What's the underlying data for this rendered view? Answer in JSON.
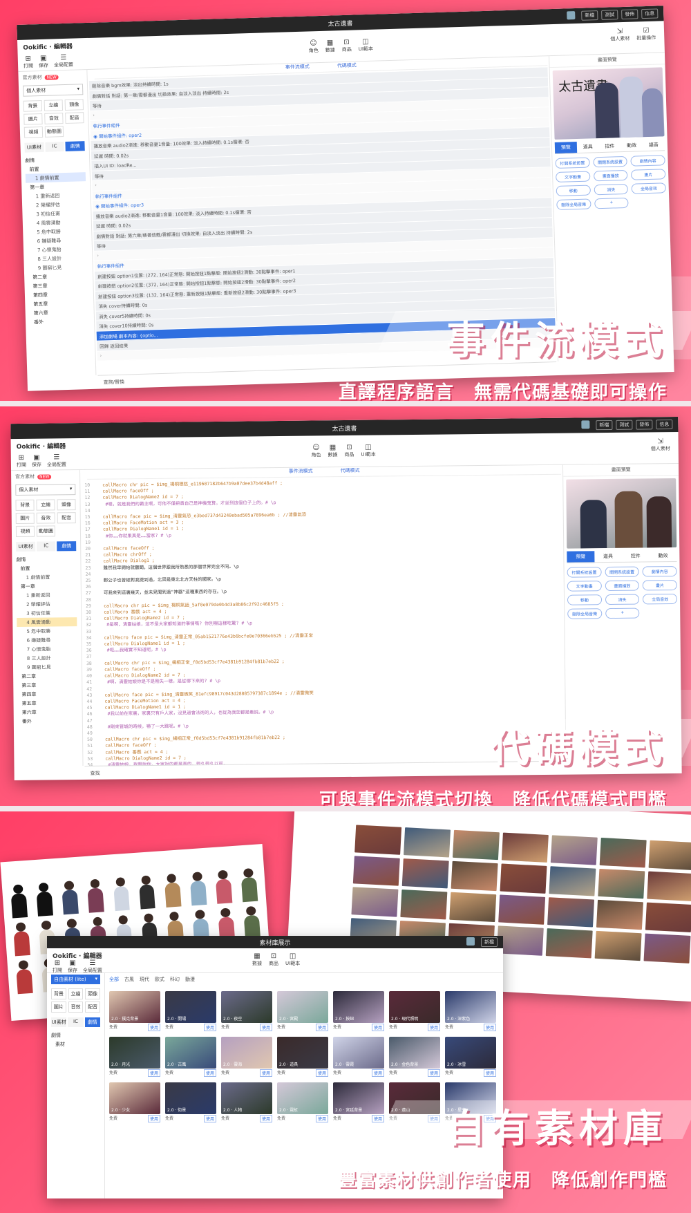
{
  "app": {
    "logo": "Ookific · 編輯器",
    "project_title": "太古遺書",
    "library_title": "素材庫展示",
    "top_controls": [
      "新檔",
      "測試",
      "發佈",
      "信息"
    ],
    "left_tools": [
      {
        "icon": "plus-icon",
        "label": "打開"
      },
      {
        "icon": "save-icon",
        "label": "保存"
      },
      {
        "icon": "list-icon",
        "label": "全局配置"
      }
    ],
    "center_tools": [
      {
        "icon": "person-icon",
        "label": "角色"
      },
      {
        "icon": "grid-icon",
        "label": "數據"
      },
      {
        "icon": "shop-icon",
        "label": "商品"
      },
      {
        "icon": "ui-icon",
        "label": "UI範本"
      }
    ],
    "right_tools": [
      {
        "icon": "import-icon",
        "label": "個人素材"
      },
      {
        "icon": "check-icon",
        "label": "批量操作"
      }
    ]
  },
  "sidebar": {
    "header": "官方素材",
    "badge": "NEW",
    "select": "個人素材",
    "categories": [
      "背景",
      "立繪",
      "頭像",
      "圖片",
      "音效",
      "配音",
      "視頻",
      "動態圖"
    ],
    "tabs": [
      "UI素材",
      "IC",
      "劇情"
    ],
    "tree": [
      {
        "label": "劇情",
        "level": 0
      },
      {
        "label": "前置",
        "level": 1
      },
      {
        "label": "1 劇情前置",
        "level": 2
      },
      {
        "label": "第一章",
        "level": 1
      },
      {
        "label": "1 重新返回",
        "level": 2
      },
      {
        "label": "2 榮耀評估",
        "level": 2
      },
      {
        "label": "3 初信任黨",
        "level": 2
      },
      {
        "label": "4 風雲湧動",
        "level": 2
      },
      {
        "label": "5 危中取勝",
        "level": 2
      },
      {
        "label": "6 嫌疑難尋",
        "level": 2
      },
      {
        "label": "7 心懷鬼胎",
        "level": 2
      },
      {
        "label": "8 三人設計",
        "level": 2
      },
      {
        "label": "9 圖窮匕見",
        "level": 2
      },
      {
        "label": "第二章",
        "level": 1
      },
      {
        "label": "第三章",
        "level": 1
      },
      {
        "label": "第四章",
        "level": 1
      },
      {
        "label": "第五章",
        "level": 1
      },
      {
        "label": "第六章",
        "level": 1
      },
      {
        "label": "番外",
        "level": 1
      }
    ]
  },
  "modes": {
    "event": "事件流模式",
    "code": "代碼模式"
  },
  "events": [
    {
      "text": "刪除音樂 bgm效果: 淡出持續時間: 1s",
      "kind": "row"
    },
    {
      "text": "劇情對話 對話: 第一章/雲都漫出 切換效果: 自淡入淡出 持續時間: 2s",
      "kind": "row"
    },
    {
      "text": "等待",
      "kind": "row"
    },
    {
      "text": "›",
      "kind": "mini"
    },
    {
      "text": "執行事件組件",
      "kind": "grp"
    },
    {
      "text": "◉ 開始事件組件: oper2",
      "kind": "grp"
    },
    {
      "text": "播放音樂 audio2漸進: 移動音量1音量: 100效果: 淡入持續時間: 0.1s循環: 否",
      "kind": "row"
    },
    {
      "text": "延遲 時間: 0.02s",
      "kind": "row"
    },
    {
      "text": "插入UI ID: loadRe...",
      "kind": "row"
    },
    {
      "text": "等待",
      "kind": "row"
    },
    {
      "text": "›",
      "kind": "mini"
    },
    {
      "text": "執行事件組件",
      "kind": "grp"
    },
    {
      "text": "◉ 開始事件組件: oper3",
      "kind": "grp"
    },
    {
      "text": "播放音樂 audio2漸進: 移動音量1音量: 100效果: 淡入持續時間: 0.1s循環: 否",
      "kind": "row"
    },
    {
      "text": "延遲 時間: 0.02s",
      "kind": "row"
    },
    {
      "text": "劇情對話 對話: 第六章/慈善信甦/雲都漫出 切換效果: 自淡入淡出 持續時間: 2s",
      "kind": "row"
    },
    {
      "text": "等待",
      "kind": "row"
    },
    {
      "text": "›",
      "kind": "mini"
    },
    {
      "text": "執行事件組件",
      "kind": "grp"
    },
    {
      "text": "創建按鈕 option1位置: (272, 164)正常態: 開始按鈕1點擊態: 開始按鈕2滑動: 30點擊事件: oper1",
      "kind": "row"
    },
    {
      "text": "創建按鈕 option2位置: (372, 164)正常態: 開始按鈕1點擊態: 開始按鈕2滑動: 30點擊事件: oper2",
      "kind": "row"
    },
    {
      "text": "創建按鈕 option3位置: (132, 164)正常態: 重新按鈕1點擊態: 重新按鈕2滑動: 30點擊事件: oper3",
      "kind": "row"
    },
    {
      "text": "消失 cover持續時間: 0s",
      "kind": "row"
    },
    {
      "text": "消失 cover5持續時間: 0s",
      "kind": "row"
    },
    {
      "text": "消失 cover10持續時間: 0s",
      "kind": "row"
    },
    {
      "text": "添加劇場 劇本內容: {optio...",
      "kind": "sel"
    },
    {
      "text": "回歸 返回結果",
      "kind": "row"
    },
    {
      "text": "›",
      "kind": "mini"
    }
  ],
  "event_footer": "查詢/替換",
  "code_lines": [
    {
      "n": "10",
      "t": "callMacro  chr  pic = $img_楊桐德怒_e119607182b647b9a07dee37b4d48aff ;"
    },
    {
      "n": "11",
      "t": "callMacro  faceOff ;"
    },
    {
      "n": "12",
      "t": "callMacro  DialogName2  id = 7 ;"
    },
    {
      "n": "13",
      "t": "  #嗯，就是我們的霸主啊，可他不僅把責自己是神機鬼算，才坐到這個位子上的。# \\p"
    },
    {
      "n": "14",
      "t": ""
    },
    {
      "n": "15",
      "t": "callMacro  face  pic = $img_清靈氣恐_e3bed737d43240ebad505a7896ea6b ;  //清靈氣恐"
    },
    {
      "n": "16",
      "t": "callMacro  FaceMotion  act = 3 ;"
    },
    {
      "n": "17",
      "t": "callMacro  DialogName1  id = 1 ;"
    },
    {
      "n": "18",
      "t": "  #你……你就果真是……當家? # \\p"
    },
    {
      "n": "19",
      "t": ""
    },
    {
      "n": "20",
      "t": "callMacro  faceOff ;"
    },
    {
      "n": "21",
      "t": "callMacro  chrOff ;"
    },
    {
      "n": "22",
      "t": "callMacro  Dialog1 ;"
    },
    {
      "n": "23",
      "t": "雖然我早開始就聽聞，這個世界跟我所熟悉的那個世界完全不同。\\p"
    },
    {
      "n": "24",
      "t": ""
    },
    {
      "n": "25",
      "t": "郵公子也曾經對我提到過，北冥是東北北方天柱的國家。\\p"
    },
    {
      "n": "26",
      "t": ""
    },
    {
      "n": "27",
      "t": "可我來到這裏幾天，並未見聞到過\"神器\"這種東西的存在。\\p"
    },
    {
      "n": "28",
      "t": ""
    },
    {
      "n": "29",
      "t": "callMacro  chr  pic = $img_楊桐氣話_5af0e079de0b4d3a8b86c2f92c4685f5 ;"
    },
    {
      "n": "30",
      "t": "callMacro  番戲  act = 4 ;"
    },
    {
      "n": "31",
      "t": "callMacro  DialogName2  id = 7 ;"
    },
    {
      "n": "32",
      "t": "  #是啊，清靈姑娘，這不是大家都知道的事情嗎? 你別嚇這樣吃驚? # \\p"
    },
    {
      "n": "33",
      "t": ""
    },
    {
      "n": "34",
      "t": "callMacro  face  pic = $img_清靈正常_05ab1521776e43b6bcfe0e70366eb525 ;  //清靈正常"
    },
    {
      "n": "35",
      "t": "callMacro  DialogName1  id = 1 ;"
    },
    {
      "n": "36",
      "t": "  #呃……我確實不知道呢。# \\p"
    },
    {
      "n": "37",
      "t": ""
    },
    {
      "n": "38",
      "t": "callMacro  chr  pic = $img_楊桐正常_f0d5bd53cf7e4381b91284fb81b7eb22 ;"
    },
    {
      "n": "39",
      "t": "callMacro  faceOff ;"
    },
    {
      "n": "40",
      "t": "callMacro  DialogName2  id = 7 ;"
    },
    {
      "n": "41",
      "t": "  #啊，清靈姑娘你是不是剛失一樣，是從哪下來的? # \\p"
    },
    {
      "n": "42",
      "t": ""
    },
    {
      "n": "43",
      "t": "callMacro  face  pic = $img_清靈微笑_81efc98917c043d28085797387c1894e ;  //清靈微笑"
    },
    {
      "n": "44",
      "t": "callMacro  FaceMotion  act = 4 ;"
    },
    {
      "n": "45",
      "t": "callMacro  DialogName1  id = 1 ;"
    },
    {
      "n": "46",
      "t": "  #我以前在家裏，家裏只有戶人家，沒見過會法術的人，也從為我您都是看說。# \\p"
    },
    {
      "n": "47",
      "t": ""
    },
    {
      "n": "48",
      "t": "  #剛來管城的時候，嚇了一大跳呢。# \\p"
    },
    {
      "n": "49",
      "t": ""
    },
    {
      "n": "50",
      "t": "callMacro  chr  pic = $img_楊桐正常_f0d5bd53cf7e4381b91284fb81b7eb22 ;"
    },
    {
      "n": "51",
      "t": "callMacro  faceOff ;"
    },
    {
      "n": "52",
      "t": "callMacro  番戲  act = 4 ;"
    },
    {
      "n": "53",
      "t": "callMacro  DialogName2  id = 7 ;"
    },
    {
      "n": "54",
      "t": "  #清靈姑娘，我跟說你，大家說的都是真的，很久很久以前，"
    }
  ],
  "code_footer": "查找",
  "preview": {
    "header": "畫面預覽",
    "title": "太古遺書",
    "tabs": [
      "預覽",
      "道具",
      "控件",
      "動效",
      "語音"
    ],
    "buttons": [
      "打開系統設置",
      "關閉系統設置",
      "劇情內容",
      "文字動畫",
      "畫面播放",
      "畫片",
      "移動",
      "消失",
      "全局音效",
      "刪除全局音樂",
      "+"
    ]
  },
  "captions": [
    {
      "title": "事件流模式",
      "subtitle": "直譯程序語言　無需代碼基礎即可操作"
    },
    {
      "title": "代碼模式",
      "subtitle": "可與事件流模式切換　降低代碼模式門檻"
    },
    {
      "title": "自有素材庫",
      "subtitle": "豐富素材供創作者使用　降低創作門檻"
    }
  ],
  "library": {
    "filters": [
      "全部",
      "古風",
      "現代",
      "歐式",
      "科幻",
      "動漫"
    ],
    "sidebar_select": "自由素材 (lite)",
    "tree": [
      "劇情",
      "素材"
    ],
    "thumbs": [
      {
        "label": "2.0 · 撲克背景",
        "price": "免費",
        "btn": "使用"
      },
      {
        "label": "2.0 · 開場",
        "price": "免費",
        "btn": "使用"
      },
      {
        "label": "2.0 · 夜空",
        "price": "免費",
        "btn": "使用"
      },
      {
        "label": "2.0 · 宮殿",
        "price": "免費",
        "btn": "使用"
      },
      {
        "label": "2.0 · 按鈕",
        "price": "免費",
        "btn": "使用"
      },
      {
        "label": "2.0 · 現代照明",
        "price": "免費",
        "btn": "使用"
      },
      {
        "label": "2.0 · 深紫色",
        "price": "免費",
        "btn": "使用"
      },
      {
        "label": "2.0 · 月光",
        "price": "免費",
        "btn": "使用"
      },
      {
        "label": "2.0 · 古風",
        "price": "免費",
        "btn": "使用"
      },
      {
        "label": "2.0 · 雲海",
        "price": "免費",
        "btn": "使用"
      },
      {
        "label": "2.0 · 道具",
        "price": "免費",
        "btn": "使用"
      },
      {
        "label": "2.0 · 雲霞",
        "price": "免費",
        "btn": "使用"
      },
      {
        "label": "2.0 · 金色背景",
        "price": "免費",
        "btn": "使用"
      },
      {
        "label": "2.0 · 冰雪",
        "price": "免費",
        "btn": "使用"
      },
      {
        "label": "2.0 · 少女",
        "price": "免費",
        "btn": "使用"
      },
      {
        "label": "2.0 · 街景",
        "price": "免費",
        "btn": "使用"
      },
      {
        "label": "2.0 · 人物",
        "price": "免費",
        "btn": "使用"
      },
      {
        "label": "2.0 · 霓虹",
        "price": "免費",
        "btn": "使用"
      },
      {
        "label": "2.0 · 宮廷背景",
        "price": "免費",
        "btn": "使用"
      },
      {
        "label": "2.0 · 遠山",
        "price": "免費",
        "btn": "使用"
      },
      {
        "label": "2.0 · 星空",
        "price": "免費",
        "btn": "使用"
      }
    ]
  },
  "colors": {
    "accent": "#2f6fe0",
    "brand": "#ff4a6e"
  }
}
